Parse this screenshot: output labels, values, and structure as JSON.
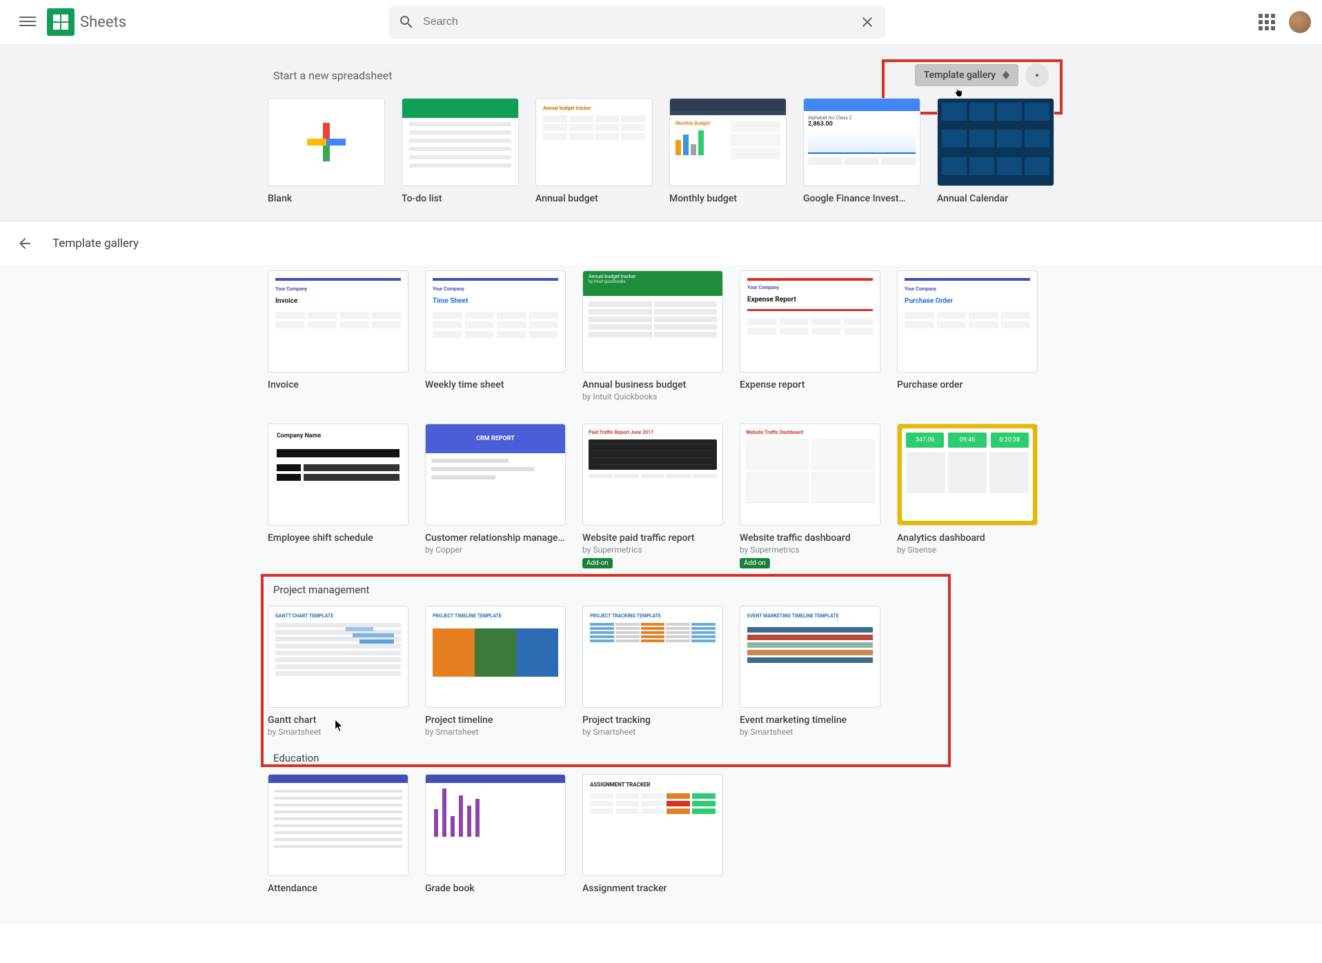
{
  "header": {
    "app_name": "Sheets",
    "search_placeholder": "Search"
  },
  "start": {
    "title": "Start a new spreadsheet",
    "template_gallery_label": "Template gallery",
    "items": [
      {
        "title": "Blank"
      },
      {
        "title": "To-do list"
      },
      {
        "title": "Annual budget",
        "thumb_label": "Annual budget tracker"
      },
      {
        "title": "Monthly budget",
        "thumb_label": "Monthly Budget"
      },
      {
        "title": "Google Finance Invest…",
        "thumb_label_1": "Alphabet Inc Class C",
        "thumb_label_2": "2,863.00"
      },
      {
        "title": "Annual Calendar"
      }
    ]
  },
  "gallery": {
    "header": "Template gallery",
    "work_row": [
      {
        "title": "Invoice",
        "doc_label_1": "Your Company",
        "doc_label_2": "Invoice"
      },
      {
        "title": "Weekly time sheet",
        "doc_label_1": "Your Company",
        "doc_label_2": "Time Sheet"
      },
      {
        "title": "Annual business budget",
        "sub": "by Intuit Quickbooks",
        "thumb_label_1": "Annual budget tracker",
        "thumb_label_2": "by Intuit quickbooks"
      },
      {
        "title": "Expense report",
        "doc_label_1": "Your Company",
        "doc_label_2": "Expense Report"
      },
      {
        "title": "Purchase order",
        "doc_label_1": "Your Company",
        "doc_label_2": "Purchase Order"
      }
    ],
    "work_row2": [
      {
        "title": "Employee shift schedule",
        "thumb_label": "Company Name"
      },
      {
        "title": "Customer relationship management",
        "sub": "by Copper",
        "thumb_label": "CRM REPORT"
      },
      {
        "title": "Website paid traffic report",
        "sub": "by Supermetrics",
        "badge": "Add-on",
        "thumb_label": "Paid Traffic Report June 2017"
      },
      {
        "title": "Website traffic dashboard",
        "sub": "by Supermetrics",
        "badge": "Add-on",
        "thumb_label": "Website Traffic Dashboard"
      },
      {
        "title": "Analytics dashboard",
        "sub": "by Sisense",
        "dash_vals": [
          "347.06",
          "09:46",
          "0:20:38"
        ]
      }
    ],
    "pm": {
      "title": "Project management",
      "items": [
        {
          "title": "Gantt chart",
          "sub": "by Smartsheet",
          "thumb_label": "GANTT CHART TEMPLATE"
        },
        {
          "title": "Project timeline",
          "sub": "by Smartsheet",
          "thumb_label": "PROJECT TIMELINE TEMPLATE"
        },
        {
          "title": "Project tracking",
          "sub": "by Smartsheet",
          "thumb_label": "PROJECT TRACKING TEMPLATE"
        },
        {
          "title": "Event marketing timeline",
          "sub": "by Smartsheet",
          "thumb_label": "EVENT MARKETING TIMELINE TEMPLATE"
        }
      ]
    },
    "edu": {
      "title": "Education",
      "items": [
        {
          "title": "Attendance"
        },
        {
          "title": "Grade book"
        },
        {
          "title": "Assignment tracker",
          "thumb_label": "ASSIGNMENT TRACKER"
        }
      ]
    }
  }
}
